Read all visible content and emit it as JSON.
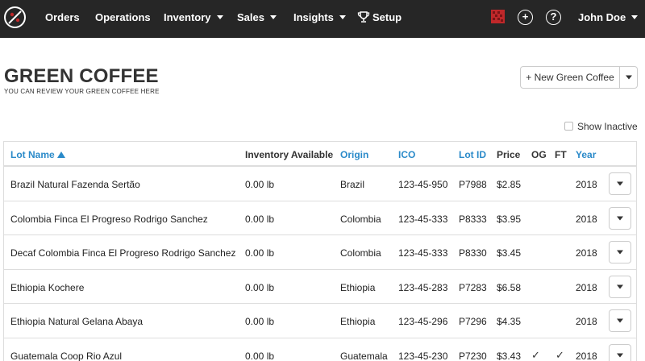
{
  "nav": {
    "items": [
      "Orders",
      "Operations",
      "Inventory",
      "Sales",
      "Insights",
      "Setup"
    ],
    "user": "John Doe",
    "help_glyph": "?",
    "add_glyph": "+"
  },
  "header": {
    "title": "GREEN COFFEE",
    "subtitle": "YOU CAN REVIEW YOUR GREEN COFFEE HERE",
    "new_button": "+ New Green Coffee",
    "show_inactive": "Show Inactive"
  },
  "table": {
    "columns": {
      "lot_name": "Lot Name",
      "inventory": "Inventory Available",
      "origin": "Origin",
      "ico": "ICO",
      "lot_id": "Lot ID",
      "price": "Price",
      "og": "OG",
      "ft": "FT",
      "year": "Year"
    },
    "rows": [
      {
        "name": "Brazil Natural Fazenda Sertão",
        "inventory": "0.00 lb",
        "origin": "Brazil",
        "ico": "123-45-950",
        "lot_id": "P7988",
        "price": "$2.85",
        "og": "",
        "ft": "",
        "year": "2018"
      },
      {
        "name": "Colombia Finca El Progreso Rodrigo Sanchez",
        "inventory": "0.00 lb",
        "origin": "Colombia",
        "ico": "123-45-333",
        "lot_id": "P8333",
        "price": "$3.95",
        "og": "",
        "ft": "",
        "year": "2018"
      },
      {
        "name": "Decaf Colombia Finca El Progreso Rodrigo Sanchez",
        "inventory": "0.00 lb",
        "origin": "Colombia",
        "ico": "123-45-333",
        "lot_id": "P8330",
        "price": "$3.45",
        "og": "",
        "ft": "",
        "year": "2018"
      },
      {
        "name": "Ethiopia Kochere",
        "inventory": "0.00 lb",
        "origin": "Ethiopia",
        "ico": "123-45-283",
        "lot_id": "P7283",
        "price": "$6.58",
        "og": "",
        "ft": "",
        "year": "2018"
      },
      {
        "name": "Ethiopia Natural Gelana Abaya",
        "inventory": "0.00 lb",
        "origin": "Ethiopia",
        "ico": "123-45-296",
        "lot_id": "P7296",
        "price": "$4.35",
        "og": "",
        "ft": "",
        "year": "2018"
      },
      {
        "name": "Guatemala Coop Rio Azul",
        "inventory": "0.00 lb",
        "origin": "Guatemala",
        "ico": "123-45-230",
        "lot_id": "P7230",
        "price": "$3.43",
        "og": "✓",
        "ft": "✓",
        "year": "2018"
      }
    ]
  }
}
